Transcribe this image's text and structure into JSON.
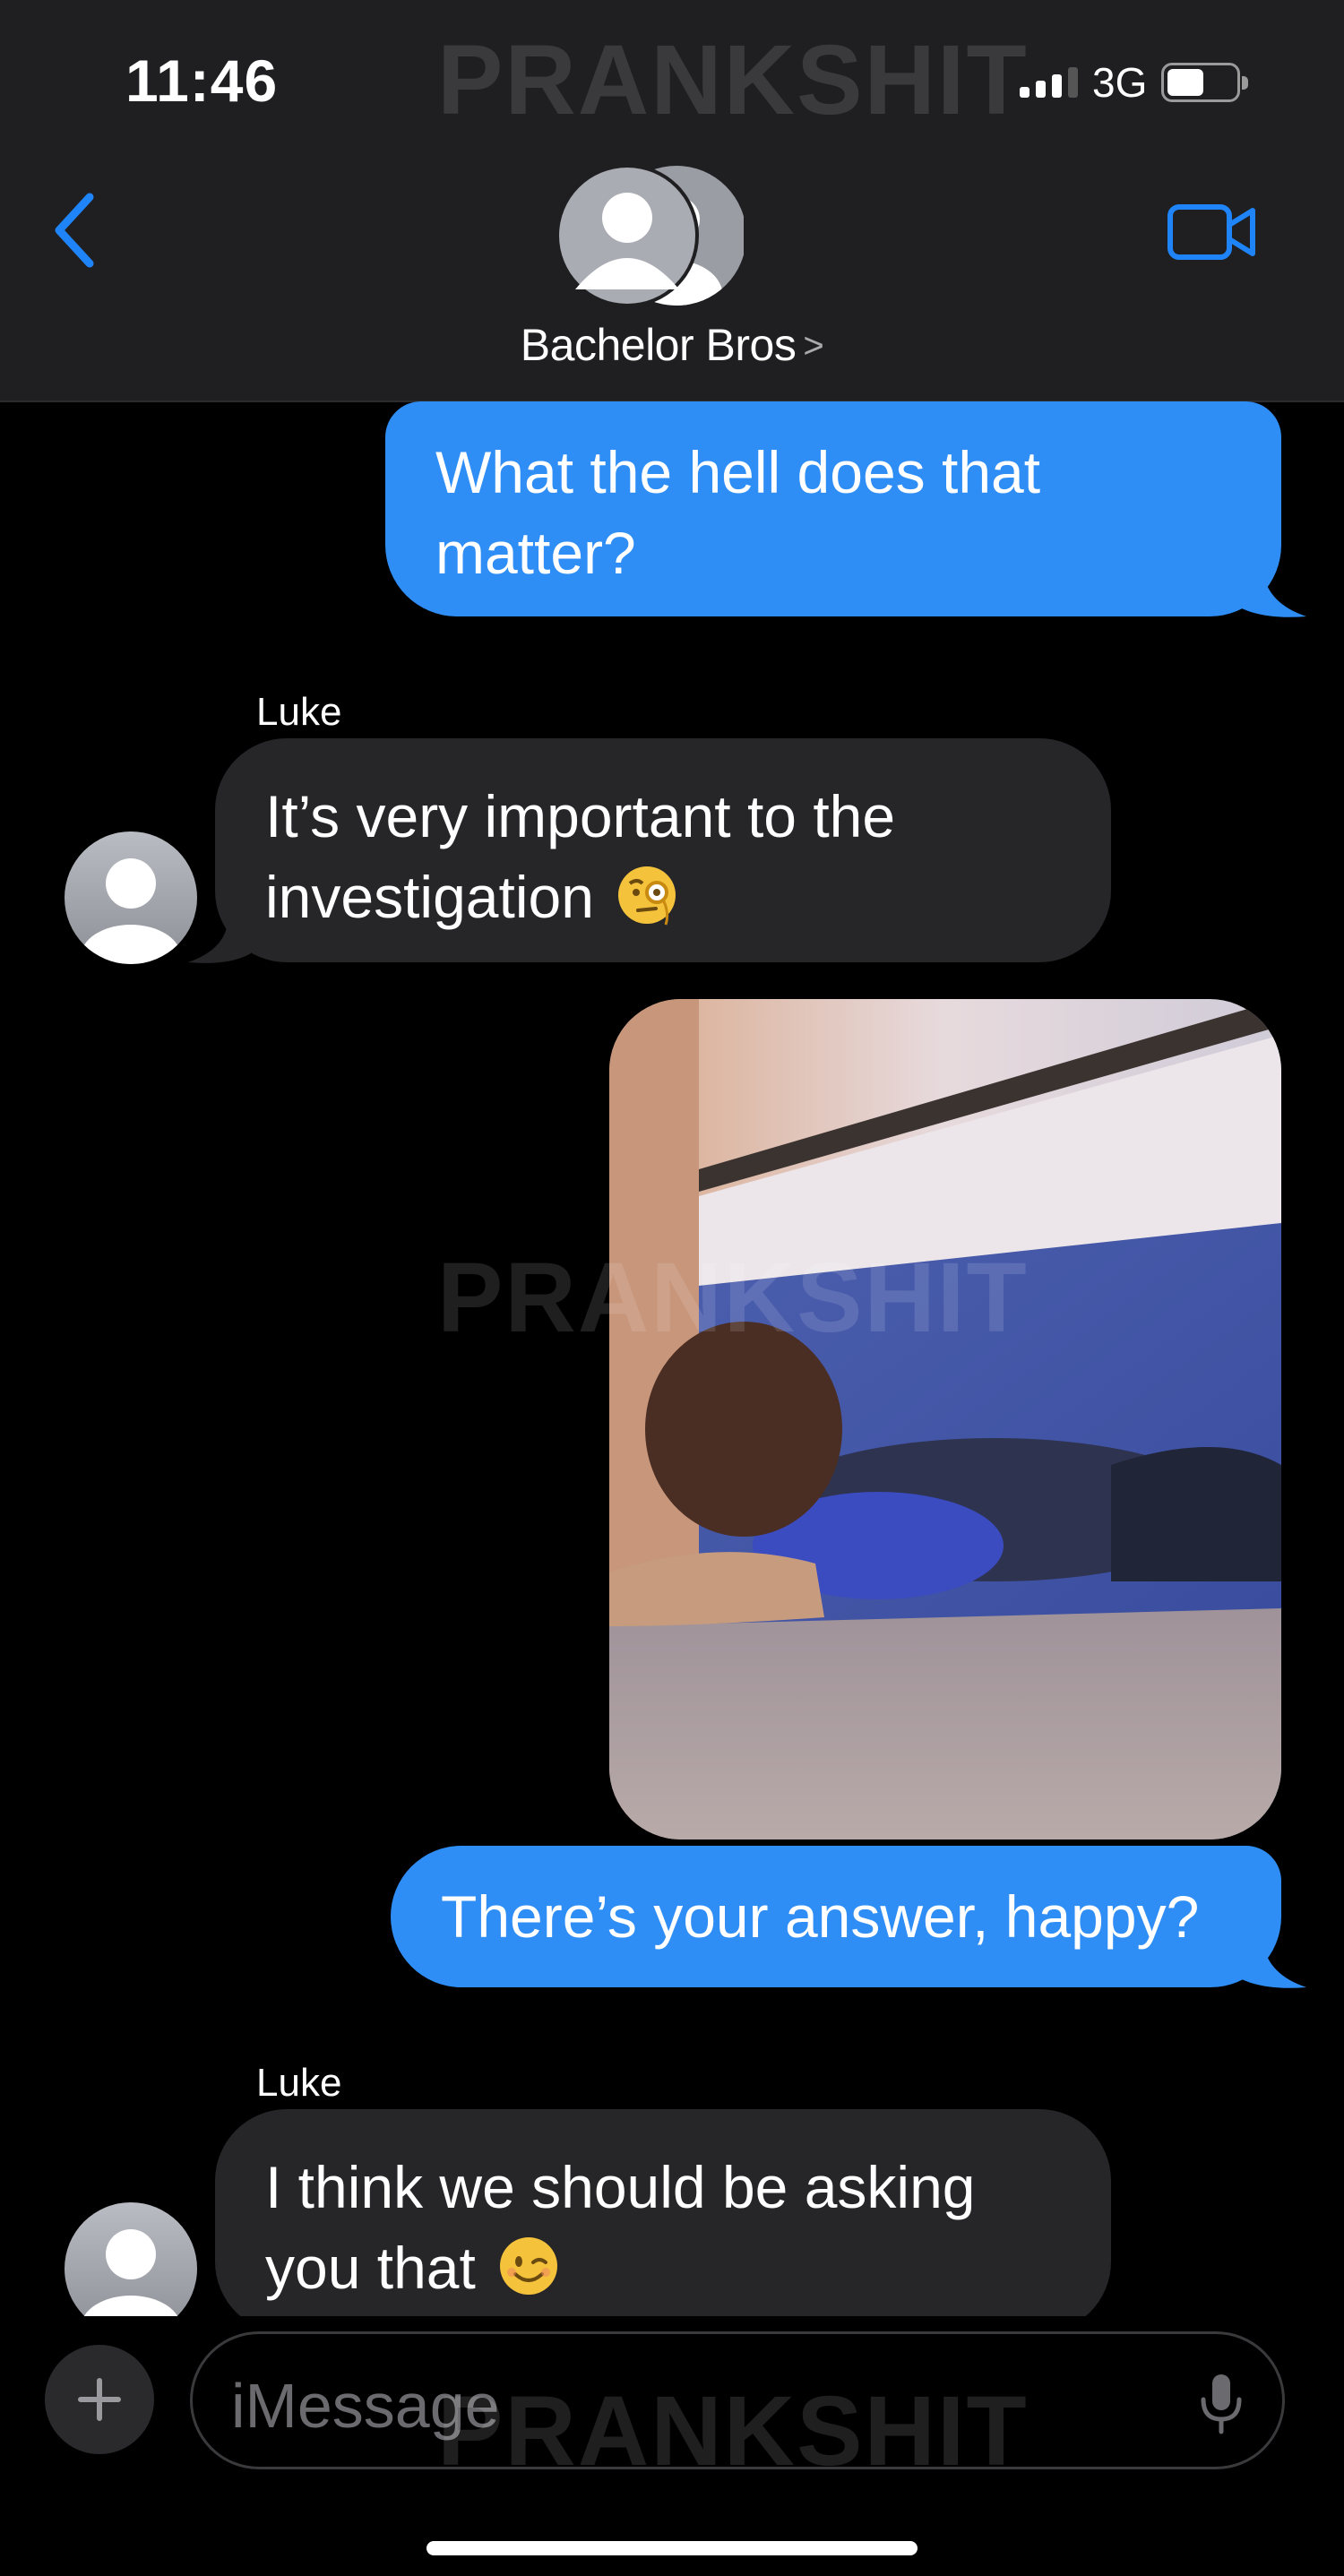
{
  "status_bar": {
    "time": "11:46",
    "network": "3G"
  },
  "watermark": "PRANKSHIT",
  "header": {
    "group_name": "Bachelor Bros",
    "chevron": ">"
  },
  "messages": [
    {
      "direction": "outgoing",
      "lines": [
        "What the hell does that",
        "matter?"
      ]
    },
    {
      "direction": "incoming",
      "sender": "Luke",
      "lines": [
        "It’s very important to the",
        "investigation"
      ],
      "emoji": "monocle-face-emoji"
    },
    {
      "direction": "outgoing",
      "type": "photo"
    },
    {
      "direction": "outgoing",
      "lines": [
        "There’s your answer, happy?"
      ]
    },
    {
      "direction": "incoming",
      "sender": "Luke",
      "lines": [
        "I think we should be asking",
        "you that"
      ],
      "emoji": "winking-face-emoji"
    }
  ],
  "composer": {
    "placeholder": "iMessage"
  },
  "colors": {
    "outgoing_bubble": "#2f8ef6",
    "incoming_bubble": "#262629",
    "accent": "#1f84f7",
    "header_bg": "#1f1f21"
  }
}
